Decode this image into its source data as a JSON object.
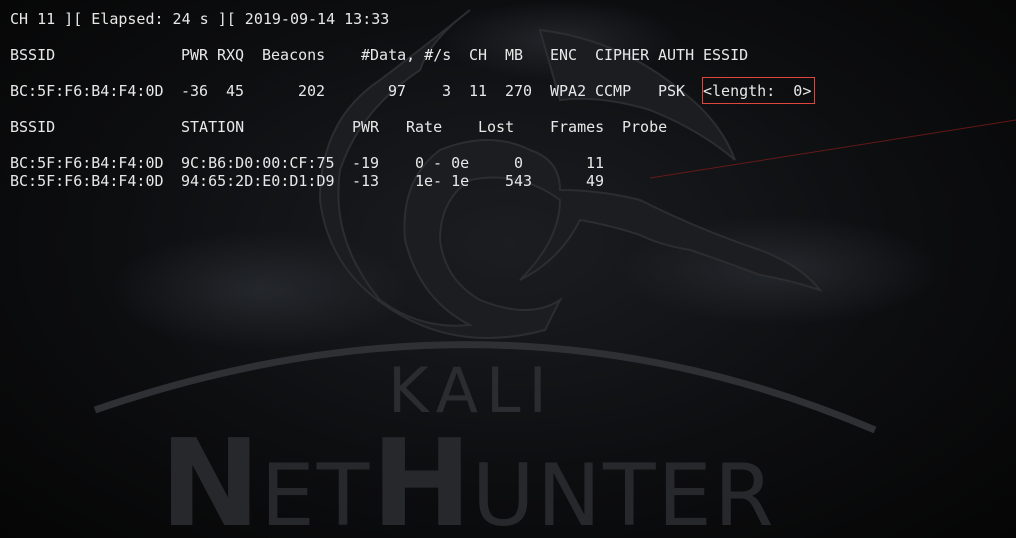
{
  "status_line": "CH 11 ][ Elapsed: 24 s ][ 2019-09-14 13:33",
  "ap_table": {
    "headers": {
      "bssid": "BSSID",
      "pwr": "PWR",
      "rxq": "RXQ",
      "beacons": "Beacons",
      "data": "#Data, #/s",
      "ch": "CH",
      "mb": "MB",
      "enc": "ENC",
      "cipher": "CIPHER",
      "auth": "AUTH",
      "essid": "ESSID"
    },
    "rows": [
      {
        "bssid": "BC:5F:F6:B4:F4:0D",
        "pwr": "-36",
        "rxq": "45",
        "beacons": "202",
        "data": "97",
        "per_sec": "3",
        "ch": "11",
        "mb": "270",
        "enc": "WPA2",
        "cipher": "CCMP",
        "auth": "PSK",
        "essid": "<length:  0>"
      }
    ]
  },
  "station_table": {
    "headers": {
      "bssid": "BSSID",
      "station": "STATION",
      "pwr": "PWR",
      "rate": "Rate",
      "lost": "Lost",
      "frames": "Frames",
      "probe": "Probe"
    },
    "rows": [
      {
        "bssid": "BC:5F:F6:B4:F4:0D",
        "station": "9C:B6:D0:00:CF:75",
        "pwr": "-19",
        "rate": "0 - 0e",
        "lost": "0",
        "frames": "11",
        "probe": ""
      },
      {
        "bssid": "BC:5F:F6:B4:F4:0D",
        "station": "94:65:2D:E0:D1:D9",
        "pwr": "-13",
        "rate": "1e- 1e",
        "lost": "543",
        "frames": "49",
        "probe": ""
      }
    ]
  },
  "wallpaper": {
    "logo_top": "KALI",
    "logo_bottom_big_1": "N",
    "logo_bottom_small_1": "ET",
    "logo_bottom_big_2": "H",
    "logo_bottom_small_2": "UNTER",
    "icon": "dragon-icon"
  },
  "colors": {
    "text": "#e8e8e8",
    "highlight_border": "#e0463c",
    "background": "#0d0e10"
  }
}
